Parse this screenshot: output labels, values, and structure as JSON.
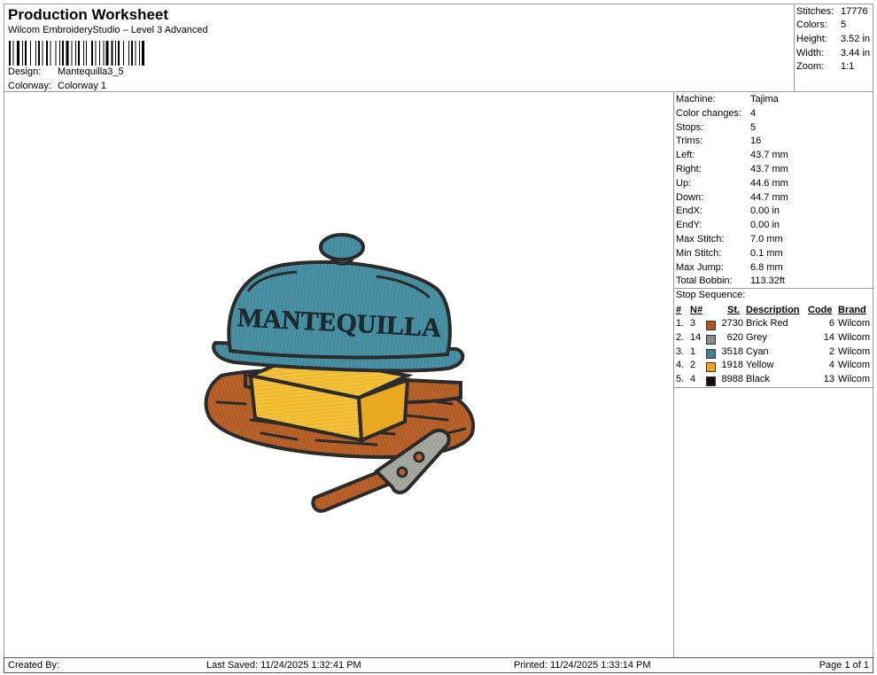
{
  "header": {
    "title": "Production Worksheet",
    "subtitle": "Wilcom EmbroideryStudio – Level 3 Advanced",
    "design_label": "Design:",
    "design_value": "Mantequilla3_5",
    "colorway_label": "Colorway:",
    "colorway_value": "Colorway 1"
  },
  "stats": [
    {
      "label": "Stitches:",
      "value": "17776"
    },
    {
      "label": "Colors:",
      "value": "5"
    },
    {
      "label": "Height:",
      "value": "3.52 in"
    },
    {
      "label": "Width:",
      "value": "3.44 in"
    },
    {
      "label": "Zoom:",
      "value": "1:1"
    }
  ],
  "machine_info": [
    {
      "label": "Machine:",
      "value": "Tajima"
    },
    {
      "label": "Color changes:",
      "value": "4"
    },
    {
      "label": "Stops:",
      "value": "5"
    },
    {
      "label": "Trims:",
      "value": "16"
    },
    {
      "label": "Left:",
      "value": "43.7 mm"
    },
    {
      "label": "Right:",
      "value": "43.7 mm"
    },
    {
      "label": "Up:",
      "value": "44.6 mm"
    },
    {
      "label": "Down:",
      "value": "44.7 mm"
    },
    {
      "label": "EndX:",
      "value": "0.00 in"
    },
    {
      "label": "EndY:",
      "value": "0.00 in"
    },
    {
      "label": "Max Stitch:",
      "value": "7.0 mm"
    },
    {
      "label": "Min Stitch:",
      "value": "0.1 mm"
    },
    {
      "label": "Max Jump:",
      "value": "6.8 mm"
    },
    {
      "label": "Total Bobbin:",
      "value": "113.32ft"
    }
  ],
  "stop_sequence": {
    "title": "Stop Sequence:",
    "columns": {
      "num": "#",
      "n": "N#",
      "st": "St.",
      "desc": "Description",
      "code": "Code",
      "brand": "Brand"
    },
    "rows": [
      {
        "num": "1.",
        "n": "3",
        "color": "#b5501f",
        "st": "2730",
        "desc": "Brick Red",
        "code": "6",
        "brand": "Wilcom"
      },
      {
        "num": "2.",
        "n": "14",
        "color": "#8a8a86",
        "st": "620",
        "desc": "Grey",
        "code": "14",
        "brand": "Wilcom"
      },
      {
        "num": "3.",
        "n": "1",
        "color": "#3d7f95",
        "st": "3518",
        "desc": "Cyan",
        "code": "2",
        "brand": "Wilcom"
      },
      {
        "num": "4.",
        "n": "2",
        "color": "#f2a21c",
        "st": "1918",
        "desc": "Yellow",
        "code": "4",
        "brand": "Wilcom"
      },
      {
        "num": "5.",
        "n": "4",
        "color": "#111111",
        "st": "8988",
        "desc": "Black",
        "code": "13",
        "brand": "Wilcom"
      }
    ]
  },
  "design_text": "MANTEQUILLA",
  "footer": {
    "created": "Created By:",
    "saved": "Last Saved: 11/24/2025 1:32:41 PM",
    "printed": "Printed: 11/24/2025 1:33:14 PM",
    "page": "Page 1 of 1"
  }
}
